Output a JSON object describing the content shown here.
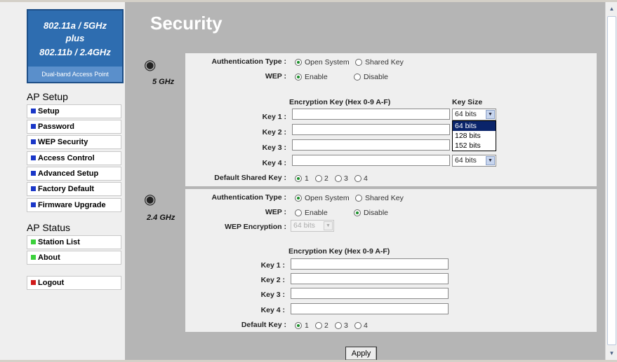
{
  "logo": {
    "line1": "802.11a / 5GHz",
    "line2": "plus",
    "line3": "802.11b / 2.4GHz",
    "subtitle": "Dual-band Access Point"
  },
  "nav": {
    "ap_setup_heading": "AP Setup",
    "setup_items": [
      "Setup",
      "Password",
      "WEP Security",
      "Access Control",
      "Advanced Setup",
      "Factory Default",
      "Firmware Upgrade"
    ],
    "ap_status_heading": "AP Status",
    "status_items": [
      "Station List",
      "About"
    ],
    "logout": "Logout",
    "colors": {
      "setup_bullet": "#1a37c8",
      "status_bullet": "#3bd13b",
      "logout_bullet": "#d01a1a"
    }
  },
  "page": {
    "title": "Security"
  },
  "band5": {
    "label": "5 GHz",
    "icon": "antenna-icon",
    "auth_label": "Authentication Type :",
    "auth_options": [
      "Open System",
      "Shared Key"
    ],
    "auth_selected": "Open System",
    "wep_label": "WEP :",
    "wep_options": [
      "Enable",
      "Disable"
    ],
    "wep_selected": "Enable",
    "enc_key_header": "Encryption Key (Hex 0-9 A-F)",
    "key_size_header": "Key Size",
    "key_labels": [
      "Key 1 :",
      "Key 2 :",
      "Key 3 :",
      "Key 4 :"
    ],
    "key_values": [
      "",
      "",
      "",
      ""
    ],
    "key1_size": "64 bits",
    "key4_size": "64 bits",
    "size_options": [
      "64 bits",
      "128 bits",
      "152 bits"
    ],
    "default_label": "Default Shared Key :",
    "default_options": [
      "1",
      "2",
      "3",
      "4"
    ],
    "default_selected": "1"
  },
  "band24": {
    "label": "2.4 GHz",
    "icon": "antenna-icon",
    "auth_label": "Authentication Type :",
    "auth_options": [
      "Open System",
      "Shared Key"
    ],
    "auth_selected": "Open System",
    "wep_label": "WEP :",
    "wep_options": [
      "Enable",
      "Disable"
    ],
    "wep_selected": "Disable",
    "wep_enc_label": "WEP Encryption :",
    "wep_enc_value": "64 bits",
    "enc_key_header": "Encryption Key (Hex 0-9 A-F)",
    "key_labels": [
      "Key 1 :",
      "Key 2 :",
      "Key 3 :",
      "Key 4 :"
    ],
    "key_values": [
      "",
      "",
      "",
      ""
    ],
    "default_label": "Default Key :",
    "default_options": [
      "1",
      "2",
      "3",
      "4"
    ],
    "default_selected": "1"
  },
  "apply_label": "Apply"
}
